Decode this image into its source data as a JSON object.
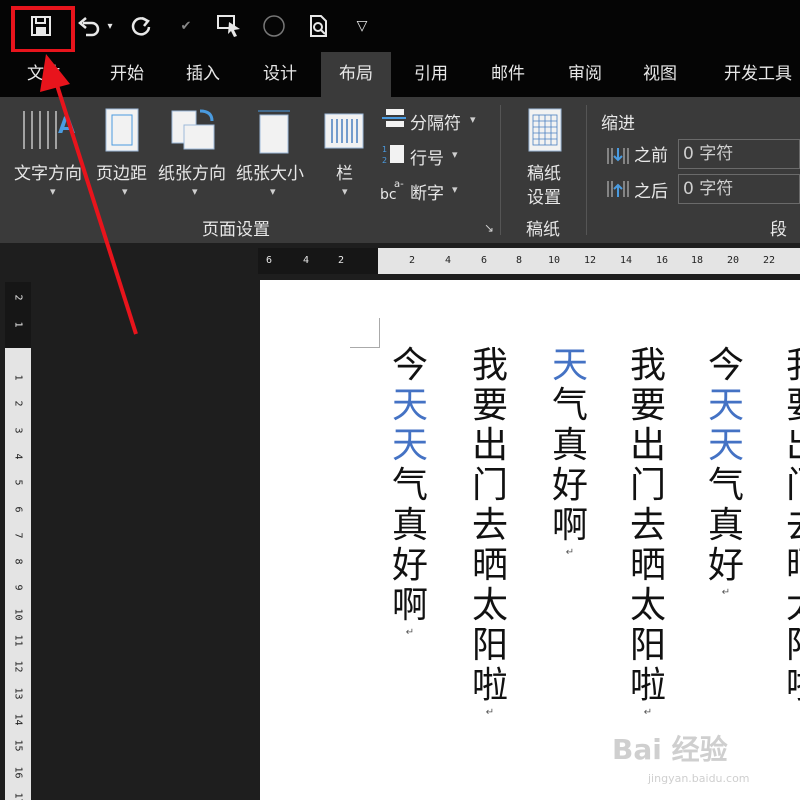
{
  "tabs": [
    "文件",
    "开始",
    "插入",
    "设计",
    "布局",
    "引用",
    "邮件",
    "审阅",
    "视图",
    "开发工具"
  ],
  "active_tab": "布局",
  "qat": {
    "icons": [
      "save-icon",
      "undo-icon",
      "redo-icon",
      "format-painter-icon",
      "touch-mode-icon",
      "circle-icon",
      "print-preview-icon",
      "customize-icon"
    ]
  },
  "page_setup": {
    "text_direction": "文字方向",
    "margins": "页边距",
    "orientation": "纸张方向",
    "size": "纸张大小",
    "columns": "栏",
    "breaks": "分隔符",
    "line_numbers": "行号",
    "hyphenation": "断字",
    "group_label": "页面设置"
  },
  "draft": {
    "button": "稿纸\n设置",
    "button_line1": "稿纸",
    "button_line2": "设置",
    "group_label": "稿纸"
  },
  "paragraph": {
    "indent_label": "缩进",
    "before_label": "之前",
    "after_label": "之后",
    "before_value": "0 字符",
    "after_value": "0 字符",
    "group_label": "段落"
  },
  "ruler": {
    "h_ticks": [
      "6",
      "4",
      "2",
      "2",
      "4",
      "6",
      "8",
      "10",
      "12",
      "14",
      "16",
      "18",
      "20",
      "22"
    ],
    "v_ticks": [
      "2",
      "1",
      "1",
      "2",
      "3",
      "4",
      "5",
      "6",
      "7",
      "8",
      "9",
      "10",
      "11",
      "12",
      "13",
      "14",
      "15",
      "16",
      "17"
    ]
  },
  "document": {
    "columns": [
      {
        "text": [
          "今",
          "天",
          "天",
          "气",
          "真",
          "好",
          "啊"
        ],
        "blue": [
          1,
          2
        ]
      },
      {
        "text": [
          "我",
          "要",
          "出",
          "门",
          "去",
          "晒",
          "太",
          "阳",
          "啦"
        ],
        "blue": []
      },
      {
        "text": [
          "天",
          "气",
          "真",
          "好",
          "啊"
        ],
        "blue": [
          0
        ]
      },
      {
        "text": [
          "我",
          "要",
          "出",
          "门",
          "去",
          "晒",
          "太",
          "阳",
          "啦"
        ],
        "blue": []
      },
      {
        "text": [
          "今",
          "天",
          "天",
          "气",
          "真",
          "好"
        ],
        "blue": [
          1,
          2
        ]
      },
      {
        "text": [
          "我",
          "要",
          "出",
          "门",
          "去",
          "晒",
          "太",
          "阳",
          "啦"
        ],
        "blue": []
      }
    ],
    "paragraph_mark": "↵"
  },
  "watermark": {
    "main": "Bai 经验",
    "sub": "jingyan.baidu.com"
  },
  "colors": {
    "highlight": "#e8141c",
    "blue_text": "#4472c4",
    "arrow": "#e8141c"
  }
}
